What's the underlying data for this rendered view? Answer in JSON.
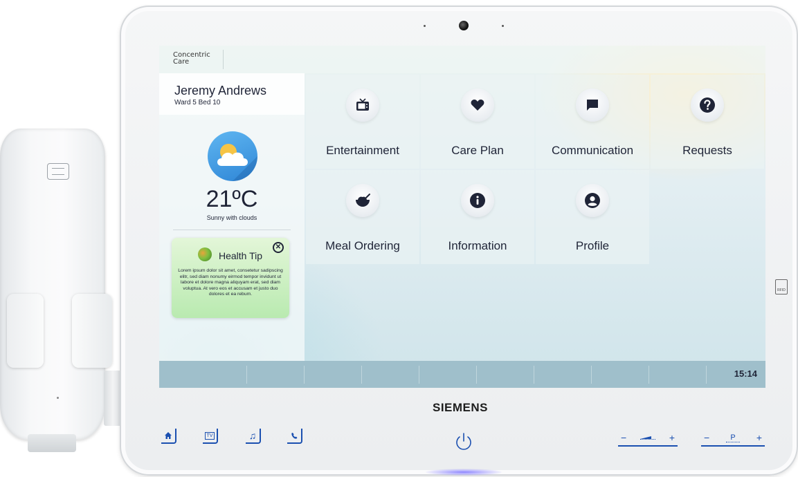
{
  "device": {
    "brand": "SIEMENS",
    "rfid_label": "RFID"
  },
  "app": {
    "name_line1": "Concentric",
    "name_line2": "Care"
  },
  "patient": {
    "name": "Jeremy Andrews",
    "location": "Ward 5 Bed 10"
  },
  "weather": {
    "temperature": "21ºC",
    "description": "Sunny with clouds",
    "icon": "partly-cloudy-icon"
  },
  "health_tip": {
    "title": "Health Tip",
    "body": "Lorem ipsum dolor sit amet, consetetur sadipscing elitr, sed diam nonumy eirmod tempor invidunt ut labore et dolore magna aliquyam erat, sed diam voluptua. At vero eos et accusam et justo duo dolores et ea rebum.",
    "close_icon": "close-circle-icon"
  },
  "tiles": [
    {
      "label": "Entertainment",
      "icon": "tv-icon"
    },
    {
      "label": "Care Plan",
      "icon": "heart-icon"
    },
    {
      "label": "Communication",
      "icon": "chat-icon"
    },
    {
      "label": "Requests",
      "icon": "help-icon"
    },
    {
      "label": "Meal Ordering",
      "icon": "meal-icon"
    },
    {
      "label": "Information",
      "icon": "info-icon"
    },
    {
      "label": "Profile",
      "icon": "user-icon"
    }
  ],
  "status_bar": {
    "time": "15:14"
  },
  "hardware_buttons": {
    "home": "home-icon",
    "tv": "TV",
    "music": "music-icon",
    "phone": "phone-icon",
    "power": "power-icon",
    "volume_minus": "−",
    "volume_plus": "+",
    "channel_minus": "−",
    "channel_label": "P",
    "channel_plus": "+"
  },
  "colors": {
    "hardware_accent": "#1a4fb0",
    "bottom_bar": "#9fbfcb",
    "health_tip_bg": "#b9eab0",
    "weather_bg": "#2f86d6",
    "text_dark": "#1f2437"
  }
}
